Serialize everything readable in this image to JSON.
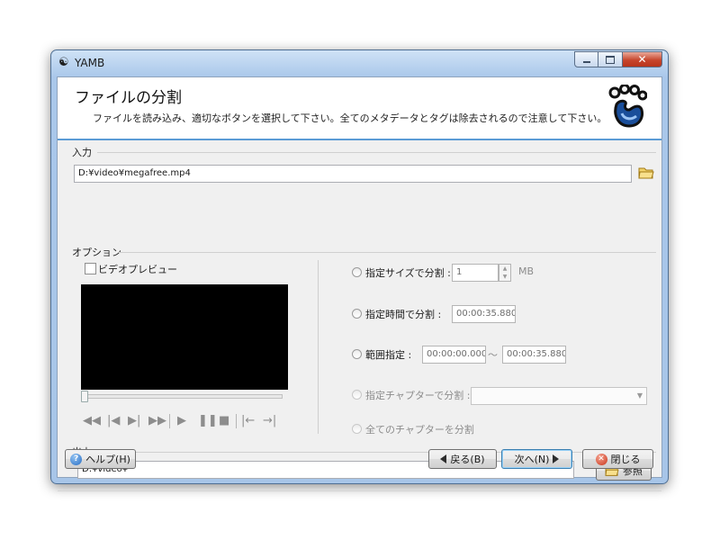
{
  "window": {
    "title": "YAMB"
  },
  "header": {
    "title": "ファイルの分割",
    "description": "ファイルを読み込み、適切なボタンを選択して下さい。全てのメタデータとタグは除去されるので注意して下さい。"
  },
  "input": {
    "group_label": "入力",
    "path": "D:¥video¥megafree.mp4"
  },
  "options": {
    "group_label": "オプション",
    "video_preview_label": "ビデオプレビュー",
    "video_preview_checked": false,
    "split_by_size": {
      "label": "指定サイズで分割 :",
      "value": "1",
      "unit": "MB"
    },
    "split_by_time": {
      "label": "指定時間で分割 :",
      "value": "00:00:35.880"
    },
    "range": {
      "label": "範囲指定 :",
      "start": "00:00:00.000",
      "separator": "〜",
      "end": "00:00:35.880"
    },
    "split_by_chapter": {
      "label": "指定チャプターで分割 :",
      "value": ""
    },
    "split_all_chapters": {
      "label": "全てのチャプターを分割"
    }
  },
  "player": {
    "controls": [
      "rewind-icon",
      "prev-frame-icon",
      "next-frame-icon",
      "fast-forward-icon",
      "play-icon",
      "pause-icon",
      "stop-icon",
      "mark-in-icon",
      "mark-out-icon"
    ]
  },
  "output": {
    "group_label": "出力",
    "path": "D:¥video¥",
    "browse_label": "参照"
  },
  "footer": {
    "help_label": "ヘルプ(H)",
    "back_label": "戻る(B)",
    "next_label": "次へ(N)",
    "close_label": "閉じる"
  },
  "colors": {
    "accent_line": "#5b9bd5",
    "title_bar": "#a9c7ea",
    "close_button": "#c7462d"
  }
}
